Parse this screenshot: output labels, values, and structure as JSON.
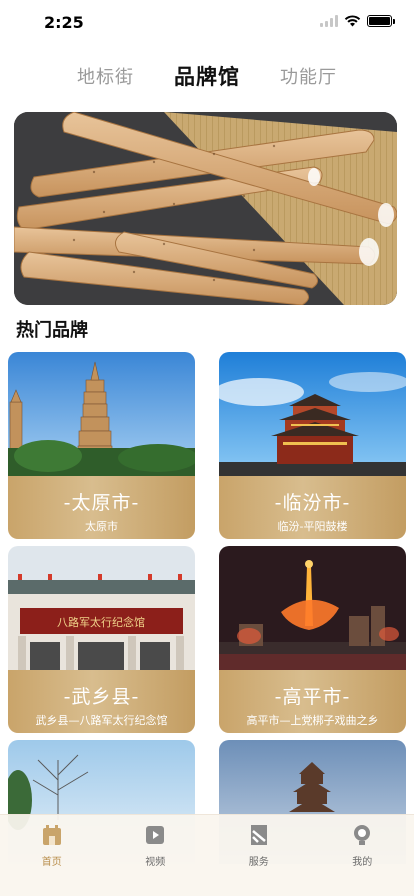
{
  "status": {
    "time": "2:25"
  },
  "tabs": [
    {
      "label": "地标街",
      "active": false
    },
    {
      "label": "品牌馆",
      "active": true
    },
    {
      "label": "功能厅",
      "active": false
    }
  ],
  "banner": {
    "alt": "yam-banner"
  },
  "section": {
    "title": "热门品牌"
  },
  "cards": [
    {
      "title": "-太原市-",
      "subtitle": "太原市"
    },
    {
      "title": "-临汾市-",
      "subtitle": "临汾-平阳鼓楼"
    },
    {
      "title": "-武乡县-",
      "subtitle": "武乡县—八路军太行纪念馆"
    },
    {
      "title": "-高平市-",
      "subtitle": "高平市—上党梆子戏曲之乡"
    }
  ],
  "gate_sign": "八路军太行纪念馆",
  "tabbar": [
    {
      "label": "首页",
      "icon": "home-icon",
      "active": true
    },
    {
      "label": "视频",
      "icon": "video-icon",
      "active": false
    },
    {
      "label": "服务",
      "icon": "service-icon",
      "active": false
    },
    {
      "label": "我的",
      "icon": "profile-icon",
      "active": false
    }
  ],
  "colors": {
    "accent": "#c9a46a",
    "active_tab": "#b98f4d"
  }
}
